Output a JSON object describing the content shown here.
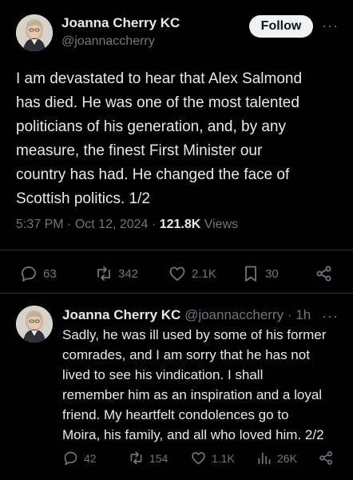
{
  "main_tweet": {
    "author_name": "Joanna Cherry KC",
    "author_handle": "@joannaccherry",
    "follow_label": "Follow",
    "more_label": "···",
    "text": "I am devastated to hear that Alex Salmond\nhas died. He was one of the most talented\npoliticians of his generation, and, by any\nmeasure, the finest First Minister our\ncountry has had. He changed the face of\nScottish politics. 1/2",
    "time": "5:37 PM",
    "date": "Oct 12, 2024",
    "separator": "·",
    "views_count": "121.8K",
    "views_label": "Views",
    "actions": {
      "replies": "63",
      "reposts": "342",
      "likes": "2.1K",
      "bookmarks": "30"
    }
  },
  "reply_tweet": {
    "author_name": "Joanna Cherry KC",
    "author_handle": "@joannaccherry",
    "separator": "·",
    "age": "1h",
    "more_label": "···",
    "text": "Sadly, he was ill used by some of his former\ncomrades, and I am sorry that he has not\nlived to see his vindication. I shall\nremember him as an inspiration and a loyal\nfriend. My heartfelt condolences go to\nMoira, his family, and all who loved him. 2/2",
    "actions": {
      "replies": "42",
      "reposts": "154",
      "likes": "1.1K",
      "views": "26K"
    }
  },
  "colors": {
    "background": "#000000",
    "text": "#e7e9ea",
    "secondary": "#71767b",
    "divider": "#2f3336",
    "follow_bg": "#eff3f4"
  }
}
